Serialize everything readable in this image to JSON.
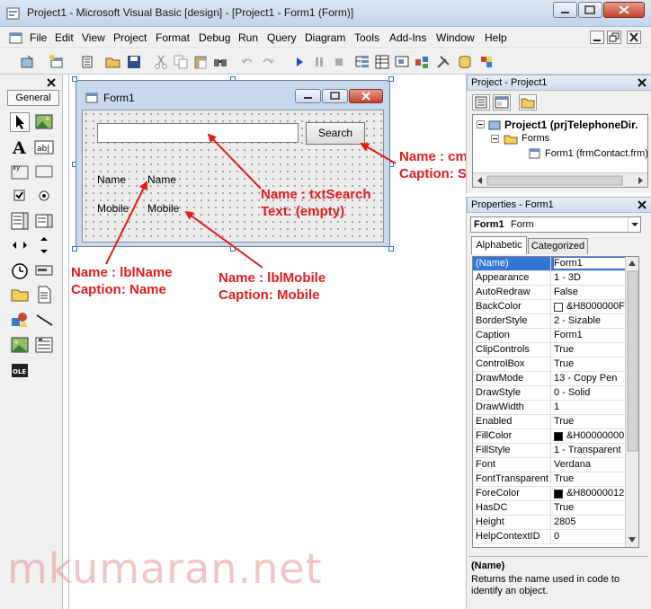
{
  "window": {
    "title": "Project1 - Microsoft Visual Basic [design] - [Project1 - Form1 (Form)]"
  },
  "menu": [
    "File",
    "Edit",
    "View",
    "Project",
    "Format",
    "Debug",
    "Run",
    "Query",
    "Diagram",
    "Tools",
    "Add-Ins",
    "Window",
    "Help"
  ],
  "toolbox": {
    "tab_label": "General"
  },
  "form": {
    "title": "Form1",
    "search_button": "Search",
    "search_text": "",
    "label_name": "Name",
    "value_name": "Name",
    "label_mobile": "Mobile",
    "value_mobile": "Mobile"
  },
  "annotations": {
    "cmd_line1": "Name : cmdSearch",
    "cmd_line2": "Caption: Search",
    "txt_line1": "Name : txtSearch",
    "txt_line2": "Text: (empty)",
    "lblname_line1": "Name : lblName",
    "lblname_line2": "Caption: Name",
    "lblmobile_line1": "Name : lblMobile",
    "lblmobile_line2": "Caption: Mobile",
    "color": "#e11d1d"
  },
  "project_panel": {
    "title": "Project - Project1",
    "root": "Project1 (prjTelephoneDir.",
    "folder": "Forms",
    "item": "Form1 (frmContact.frm)"
  },
  "properties_panel": {
    "title": "Properties - Form1",
    "object_name": "Form1",
    "object_type": "Form",
    "tab_alphabetic": "Alphabetic",
    "tab_categorized": "Categorized",
    "rows": [
      {
        "name": "(Name)",
        "value": "Form1"
      },
      {
        "name": "Appearance",
        "value": "1 - 3D"
      },
      {
        "name": "AutoRedraw",
        "value": "False"
      },
      {
        "name": "BackColor",
        "value": "&H8000000F"
      },
      {
        "name": "BorderStyle",
        "value": "2 - Sizable"
      },
      {
        "name": "Caption",
        "value": "Form1"
      },
      {
        "name": "ClipControls",
        "value": "True"
      },
      {
        "name": "ControlBox",
        "value": "True"
      },
      {
        "name": "DrawMode",
        "value": "13 - Copy Pen"
      },
      {
        "name": "DrawStyle",
        "value": "0 - Solid"
      },
      {
        "name": "DrawWidth",
        "value": "1"
      },
      {
        "name": "Enabled",
        "value": "True"
      },
      {
        "name": "FillColor",
        "value": "&H00000000"
      },
      {
        "name": "FillStyle",
        "value": "1 - Transparent"
      },
      {
        "name": "Font",
        "value": "Verdana"
      },
      {
        "name": "FontTransparent",
        "value": "True"
      },
      {
        "name": "ForeColor",
        "value": "&H80000012"
      },
      {
        "name": "HasDC",
        "value": "True"
      },
      {
        "name": "Height",
        "value": "2805"
      },
      {
        "name": "HelpContextID",
        "value": "0"
      }
    ],
    "desc_title": "(Name)",
    "desc_text": "Returns the name used in code to identify an object."
  },
  "watermark": "mkumaran.net"
}
